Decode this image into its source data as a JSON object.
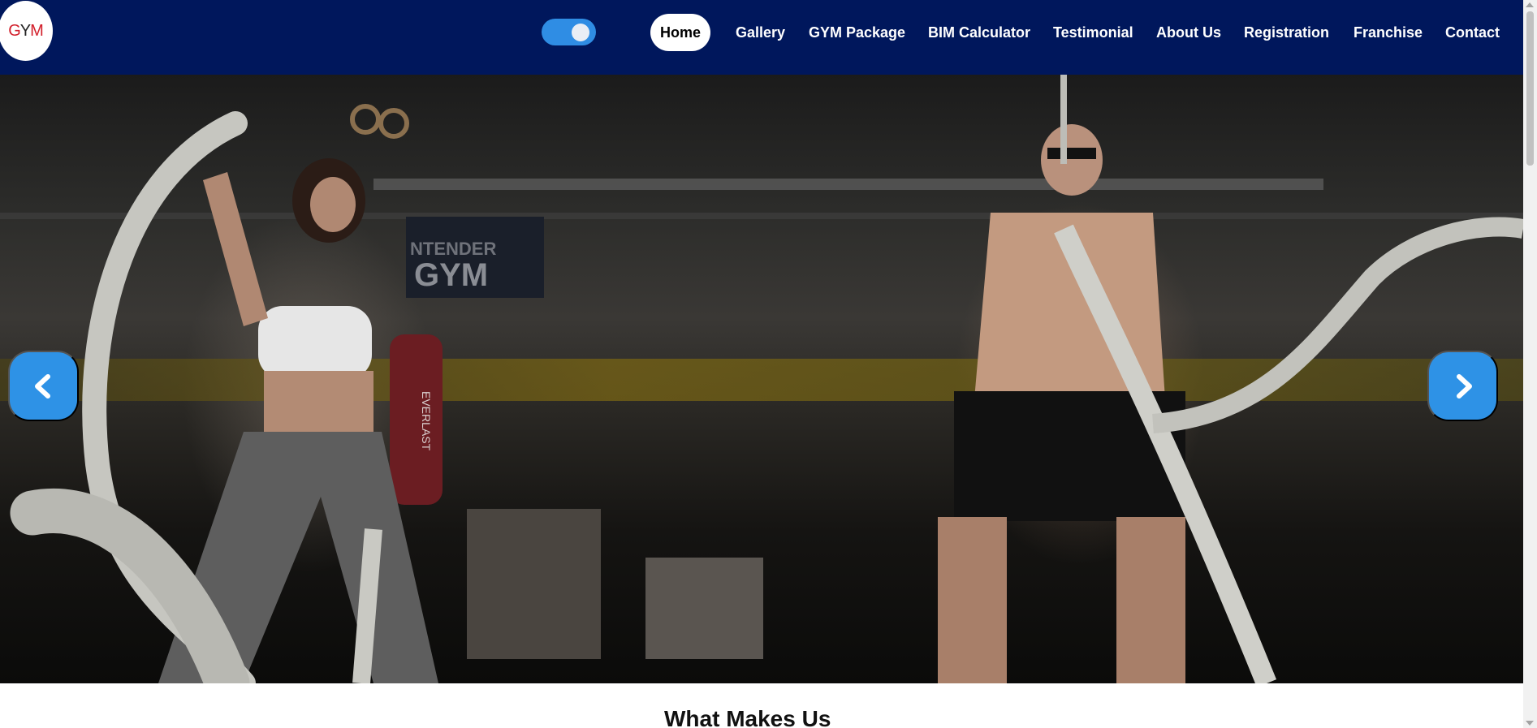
{
  "brand": {
    "logo_text_g": "G",
    "logo_text_y": "Y",
    "logo_text_m": "M"
  },
  "theme_toggle": {
    "state": "on"
  },
  "nav": {
    "items": [
      {
        "label": "Home",
        "active": true
      },
      {
        "label": "Gallery"
      },
      {
        "label": "GYM Package"
      },
      {
        "label": "BIM Calculator"
      },
      {
        "label": "Testimonial"
      },
      {
        "label": "About Us"
      },
      {
        "label": "Registration"
      },
      {
        "label": "Franchise"
      },
      {
        "label": "Contact"
      }
    ]
  },
  "hero": {
    "prev_icon": "chevron-left-icon",
    "next_icon": "chevron-right-icon",
    "wall_sign": "NTENDER GYM",
    "bag_text": "EVERLAST"
  },
  "section": {
    "title": "What Makes Us"
  },
  "colors": {
    "navbar": "#00175c",
    "accent": "#2e92e6",
    "active_pill": "#ffffff"
  }
}
